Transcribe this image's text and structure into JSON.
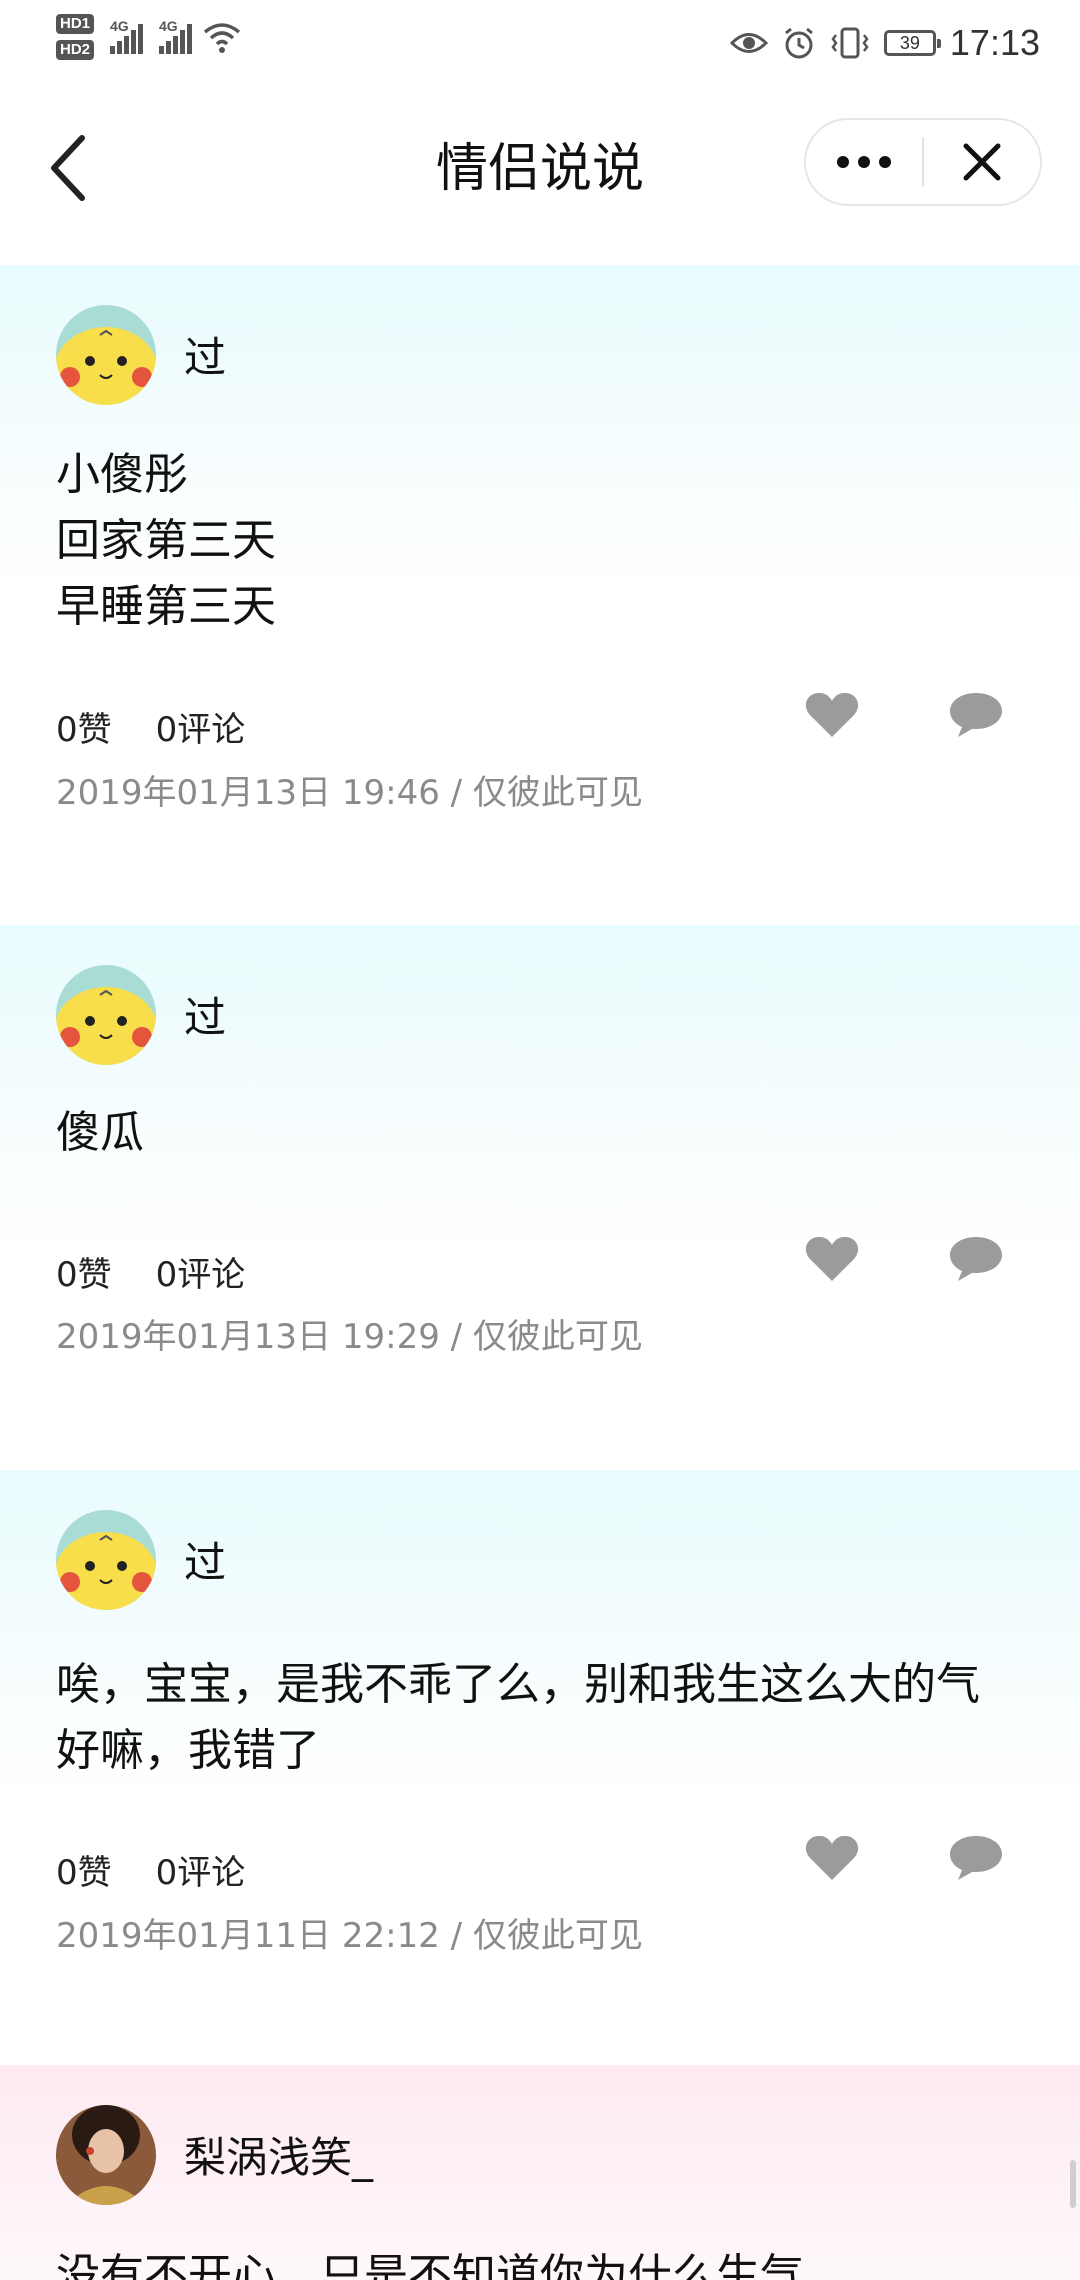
{
  "status_bar": {
    "hd1": "HD1",
    "hd2": "HD2",
    "net1": "4G",
    "net2": "4G",
    "battery": "39",
    "time": "17:13"
  },
  "header": {
    "title": "情侣说说",
    "back_icon": "back-arrow-icon",
    "more_icon": "more-dots-icon",
    "close_icon": "close-icon"
  },
  "posts": [
    {
      "author": "过",
      "content": "小傻彤\n回家第三天\n早睡第三天",
      "likes": "0赞",
      "comments": "0评论",
      "meta": "2019年01月13日 19:46 / 仅彼此可见"
    },
    {
      "author": "过",
      "content": "傻瓜",
      "likes": "0赞",
      "comments": "0评论",
      "meta": "2019年01月13日 19:29 / 仅彼此可见"
    },
    {
      "author": "过",
      "content": "唉，宝宝，是我不乖了么，别和我生这么大的气好嘛，我错了",
      "likes": "0赞",
      "comments": "0评论",
      "meta": "2019年01月11日 22:12 / 仅彼此可见"
    },
    {
      "author": "梨涡浅笑_",
      "content": "没有不开心，只是不知道你为什么生气"
    }
  ],
  "colors": {
    "post_bg_him": "#e8fbfd",
    "post_bg_her": "#fde9f1",
    "icon_gray": "#9b9b9b",
    "meta_gray": "#8a8a8a"
  }
}
